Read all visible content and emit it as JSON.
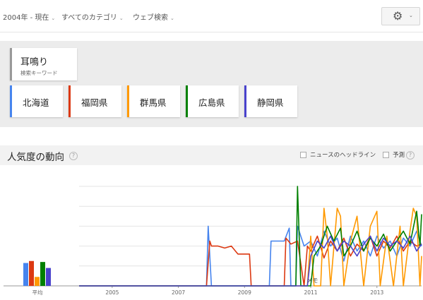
{
  "toolbar": {
    "period_label": "2004年 - 現在",
    "category_label": "すべてのカテゴリ",
    "search_type_label": "ウェブ検索",
    "caret": "⌄",
    "settings_icon": "⚙"
  },
  "search_term": {
    "term": "耳鳴り",
    "subtitle": "検索キーワード",
    "border_color": "#999999"
  },
  "regions": [
    {
      "label": "北海道",
      "color": "#4684ee"
    },
    {
      "label": "福岡県",
      "color": "#dc3912"
    },
    {
      "label": "群馬県",
      "color": "#ff9900"
    },
    {
      "label": "広島県",
      "color": "#008000"
    },
    {
      "label": "静岡県",
      "color": "#4942cc"
    }
  ],
  "section": {
    "title": "人気度の動向",
    "help": "?",
    "news_headlines_label": "ニュースのヘッドライン",
    "forecast_label": "予測"
  },
  "chart_data": {
    "type": "line",
    "x_ticks": [
      "2005",
      "2007",
      "2009",
      "2011",
      "2013"
    ],
    "note_marker": "メモ",
    "average_label": "平均",
    "averages": [
      {
        "series": "北海道",
        "value": 23
      },
      {
        "series": "福岡県",
        "value": 25
      },
      {
        "series": "群馬県",
        "value": 9
      },
      {
        "series": "広島県",
        "value": 24
      },
      {
        "series": "静岡県",
        "value": 18
      }
    ],
    "y_range": [
      0,
      100
    ],
    "gridlines": true,
    "series": [
      {
        "name": "北海道",
        "points": [
          [
            2004.0,
            0
          ],
          [
            2007.85,
            0
          ],
          [
            2007.9,
            60
          ],
          [
            2008.0,
            0
          ],
          [
            2009.75,
            0
          ],
          [
            2009.8,
            45
          ],
          [
            2010.1,
            45
          ],
          [
            2010.2,
            45
          ],
          [
            2010.35,
            58
          ],
          [
            2010.4,
            0
          ],
          [
            2010.55,
            0
          ],
          [
            2010.6,
            60
          ],
          [
            2010.8,
            40
          ],
          [
            2011.0,
            45
          ],
          [
            2011.2,
            30
          ],
          [
            2011.4,
            55
          ],
          [
            2011.6,
            40
          ],
          [
            2011.8,
            48
          ],
          [
            2012.0,
            25
          ],
          [
            2012.2,
            50
          ],
          [
            2012.4,
            35
          ],
          [
            2012.6,
            45
          ],
          [
            2012.8,
            30
          ],
          [
            2013.0,
            50
          ],
          [
            2013.2,
            38
          ],
          [
            2013.4,
            45
          ],
          [
            2013.6,
            30
          ],
          [
            2013.8,
            48
          ],
          [
            2014.0,
            40
          ],
          [
            2014.2,
            55
          ],
          [
            2014.35,
            40
          ]
        ]
      },
      {
        "name": "福岡県",
        "points": [
          [
            2004.0,
            0
          ],
          [
            2007.85,
            0
          ],
          [
            2007.95,
            45
          ],
          [
            2008.0,
            40
          ],
          [
            2008.2,
            40
          ],
          [
            2008.4,
            38
          ],
          [
            2008.6,
            40
          ],
          [
            2008.8,
            32
          ],
          [
            2009.0,
            32
          ],
          [
            2009.15,
            32
          ],
          [
            2009.2,
            0
          ],
          [
            2010.2,
            0
          ],
          [
            2010.25,
            48
          ],
          [
            2010.4,
            42
          ],
          [
            2010.6,
            45
          ],
          [
            2010.8,
            0
          ],
          [
            2010.9,
            40
          ],
          [
            2011.0,
            35
          ],
          [
            2011.2,
            50
          ],
          [
            2011.4,
            28
          ],
          [
            2011.6,
            45
          ],
          [
            2011.8,
            35
          ],
          [
            2012.0,
            48
          ],
          [
            2012.2,
            30
          ],
          [
            2012.4,
            42
          ],
          [
            2012.6,
            35
          ],
          [
            2012.8,
            50
          ],
          [
            2013.0,
            30
          ],
          [
            2013.2,
            45
          ],
          [
            2013.4,
            38
          ],
          [
            2013.6,
            50
          ],
          [
            2013.8,
            35
          ],
          [
            2014.0,
            45
          ],
          [
            2014.2,
            40
          ],
          [
            2014.35,
            42
          ]
        ]
      },
      {
        "name": "群馬県",
        "points": [
          [
            2004.0,
            0
          ],
          [
            2010.9,
            0
          ],
          [
            2011.0,
            50
          ],
          [
            2011.1,
            0
          ],
          [
            2011.3,
            0
          ],
          [
            2011.4,
            78
          ],
          [
            2011.5,
            50
          ],
          [
            2011.6,
            0
          ],
          [
            2011.8,
            78
          ],
          [
            2011.9,
            70
          ],
          [
            2012.0,
            0
          ],
          [
            2012.2,
            45
          ],
          [
            2012.4,
            70
          ],
          [
            2012.6,
            0
          ],
          [
            2012.8,
            60
          ],
          [
            2013.0,
            75
          ],
          [
            2013.1,
            0
          ],
          [
            2013.3,
            50
          ],
          [
            2013.5,
            0
          ],
          [
            2013.7,
            60
          ],
          [
            2013.8,
            0
          ],
          [
            2014.0,
            55
          ],
          [
            2014.1,
            78
          ],
          [
            2014.2,
            70
          ],
          [
            2014.3,
            0
          ],
          [
            2014.35,
            30
          ]
        ]
      },
      {
        "name": "広島県",
        "points": [
          [
            2004.0,
            0
          ],
          [
            2010.55,
            0
          ],
          [
            2010.6,
            100
          ],
          [
            2010.7,
            0
          ],
          [
            2011.0,
            0
          ],
          [
            2011.1,
            30
          ],
          [
            2011.3,
            40
          ],
          [
            2011.5,
            60
          ],
          [
            2011.7,
            45
          ],
          [
            2011.9,
            58
          ],
          [
            2012.0,
            30
          ],
          [
            2012.2,
            40
          ],
          [
            2012.4,
            55
          ],
          [
            2012.6,
            35
          ],
          [
            2012.8,
            48
          ],
          [
            2013.0,
            40
          ],
          [
            2013.2,
            52
          ],
          [
            2013.4,
            35
          ],
          [
            2013.6,
            45
          ],
          [
            2013.8,
            55
          ],
          [
            2014.0,
            42
          ],
          [
            2014.2,
            75
          ],
          [
            2014.3,
            40
          ],
          [
            2014.35,
            72
          ]
        ]
      },
      {
        "name": "静岡県",
        "points": [
          [
            2004.0,
            0
          ],
          [
            2010.9,
            0
          ],
          [
            2011.0,
            30
          ],
          [
            2011.2,
            45
          ],
          [
            2011.4,
            38
          ],
          [
            2011.6,
            50
          ],
          [
            2011.8,
            35
          ],
          [
            2012.0,
            45
          ],
          [
            2012.2,
            40
          ],
          [
            2012.4,
            30
          ],
          [
            2012.6,
            42
          ],
          [
            2012.8,
            50
          ],
          [
            2013.0,
            35
          ],
          [
            2013.2,
            48
          ],
          [
            2013.4,
            40
          ],
          [
            2013.6,
            45
          ],
          [
            2013.8,
            38
          ],
          [
            2014.0,
            50
          ],
          [
            2014.2,
            35
          ],
          [
            2014.35,
            42
          ]
        ]
      }
    ]
  }
}
